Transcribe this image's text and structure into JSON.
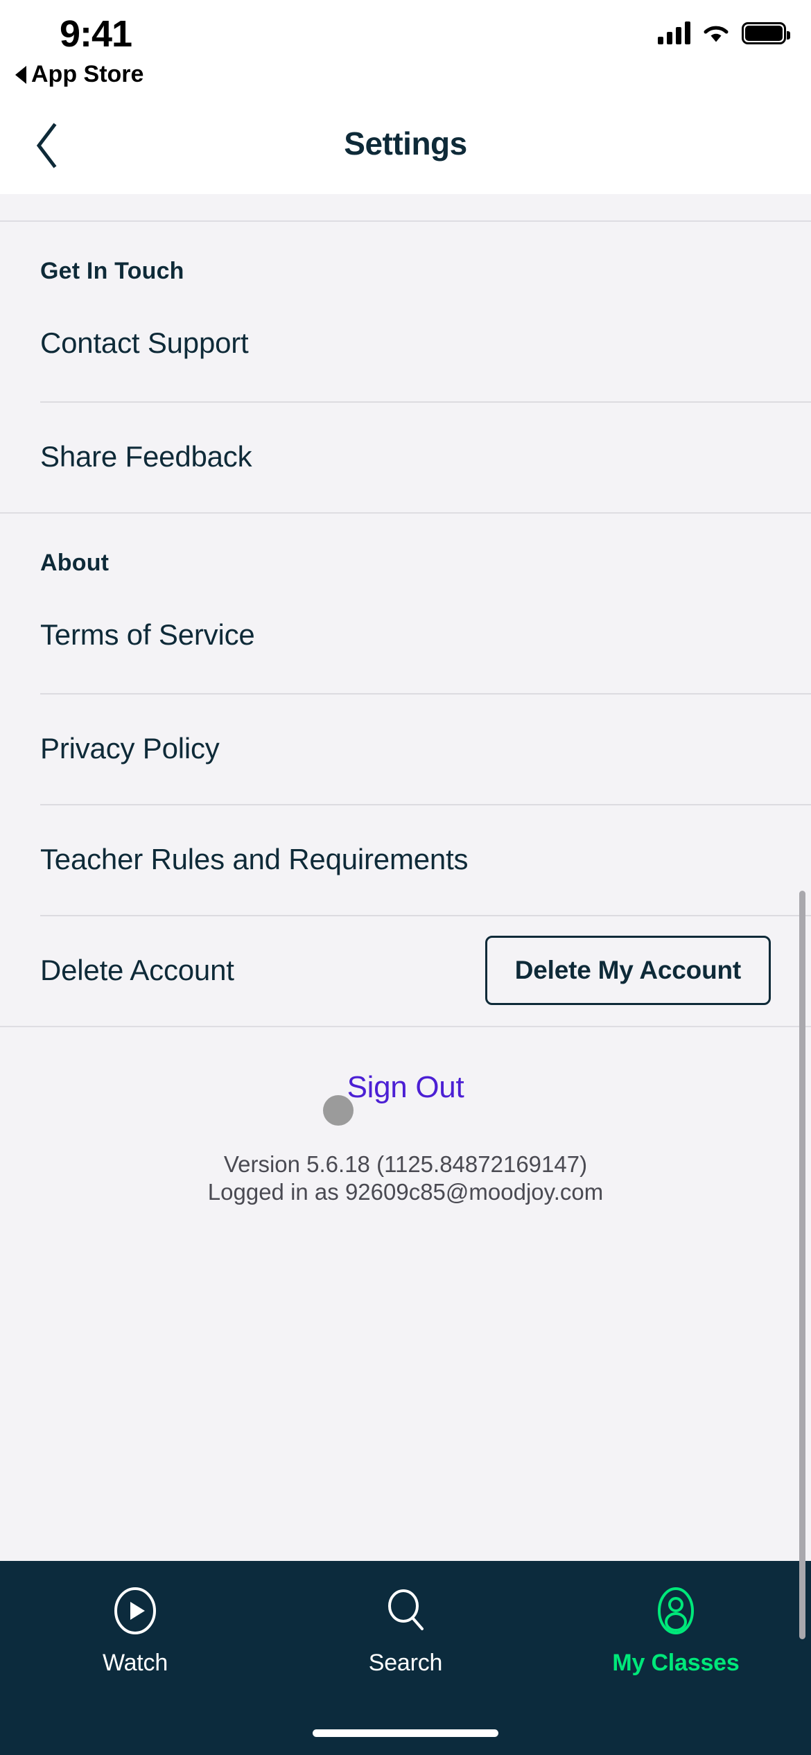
{
  "status_bar": {
    "time": "9:41",
    "back_app_label": "App Store",
    "icons": [
      "cellular-signal-icon",
      "wifi-icon",
      "battery-icon"
    ]
  },
  "nav_bar": {
    "title": "Settings",
    "back_icon": "chevron-left-icon"
  },
  "sections": [
    {
      "header": "Get In Touch",
      "rows": [
        {
          "label": "Contact Support"
        },
        {
          "label": "Share Feedback"
        }
      ]
    },
    {
      "header": "About",
      "rows": [
        {
          "label": "Terms of Service"
        },
        {
          "label": "Privacy Policy"
        },
        {
          "label": "Teacher Rules and Requirements"
        },
        {
          "label": "Delete Account",
          "action_label": "Delete My Account"
        }
      ]
    }
  ],
  "footer": {
    "sign_out_label": "Sign Out",
    "version_line": "Version 5.6.18 (1125.84872169147)",
    "logged_in_line": "Logged in as 92609c85@moodjoy.com"
  },
  "tab_bar": {
    "tabs": [
      {
        "label": "Watch",
        "icon": "play-circle-icon",
        "active": false
      },
      {
        "label": "Search",
        "icon": "search-icon",
        "active": false
      },
      {
        "label": "My Classes",
        "icon": "person-icon",
        "active": true
      }
    ]
  },
  "colors": {
    "navy": "#0E2A38",
    "tab_bar_bg": "#0C2B3D",
    "accent_green": "#00E87A",
    "sign_out_purple": "#4B1FD4",
    "page_bg": "#F4F3F6",
    "divider": "#DCDBE0"
  }
}
